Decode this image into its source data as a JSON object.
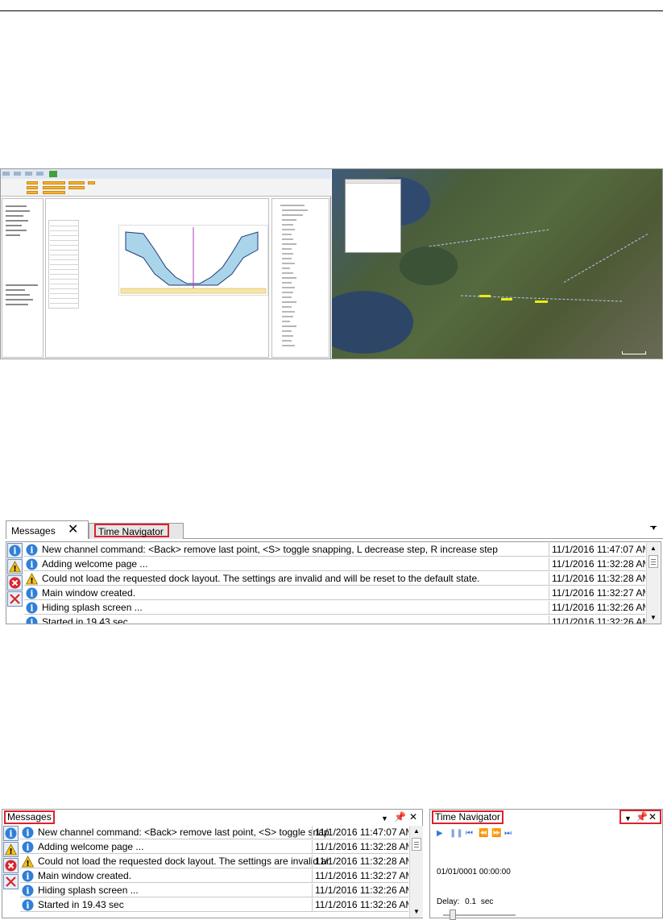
{
  "screenshot2": {
    "tab_messages": "Messages",
    "tab_time_navigator": "Time Navigator",
    "rows": [
      {
        "type": "info",
        "text": "New channel command: <Back> remove last point, <S> toggle snapping, L decrease step, R increase step",
        "time": "11/1/2016 11:47:07 AM"
      },
      {
        "type": "info",
        "text": "Adding welcome page ...",
        "time": "11/1/2016 11:32:28 AM"
      },
      {
        "type": "warning",
        "text": "Could not load the requested dock layout. The settings are invalid and will be reset to the default state.",
        "time": "11/1/2016 11:32:28 AM"
      },
      {
        "type": "info",
        "text": "Main window created.",
        "time": "11/1/2016 11:32:27 AM"
      },
      {
        "type": "info",
        "text": "Hiding splash screen ...",
        "time": "11/1/2016 11:32:26 AM"
      },
      {
        "type": "info",
        "text": "Started in 19.43 sec",
        "time": "11/1/2016 11:32:26 AM"
      }
    ]
  },
  "screenshot3": {
    "messages_title": "Messages",
    "time_navigator_title": "Time Navigator",
    "rows": [
      {
        "type": "info",
        "text": "New channel command: <Back> remove last point, <S> toggle snap",
        "time": "11/1/2016 11:47:07 AM"
      },
      {
        "type": "info",
        "text": "Adding welcome page ...",
        "time": "11/1/2016 11:32:28 AM"
      },
      {
        "type": "warning",
        "text": "Could not load the requested dock layout. The settings are invalid ar",
        "time": "11/1/2016 11:32:28 AM"
      },
      {
        "type": "info",
        "text": "Main window created.",
        "time": "11/1/2016 11:32:27 AM"
      },
      {
        "type": "info",
        "text": "Hiding splash screen ...",
        "time": "11/1/2016 11:32:26 AM"
      },
      {
        "type": "info",
        "text": "Started in 19.43 sec",
        "time": "11/1/2016 11:32:26 AM"
      }
    ],
    "time_navigator": {
      "current_time": "01/01/0001 00:00:00",
      "delay_label": "Delay:",
      "delay_value": "0.1",
      "delay_unit": "sec"
    }
  },
  "icons": {
    "info": "info-icon",
    "warning": "warning-icon",
    "error": "error-icon",
    "clear": "clear-icon"
  },
  "colors": {
    "highlight_red": "#d9232e",
    "info_blue": "#2f7fd6",
    "warning_yellow": "#f4c21b",
    "error_red": "#d7262d"
  }
}
